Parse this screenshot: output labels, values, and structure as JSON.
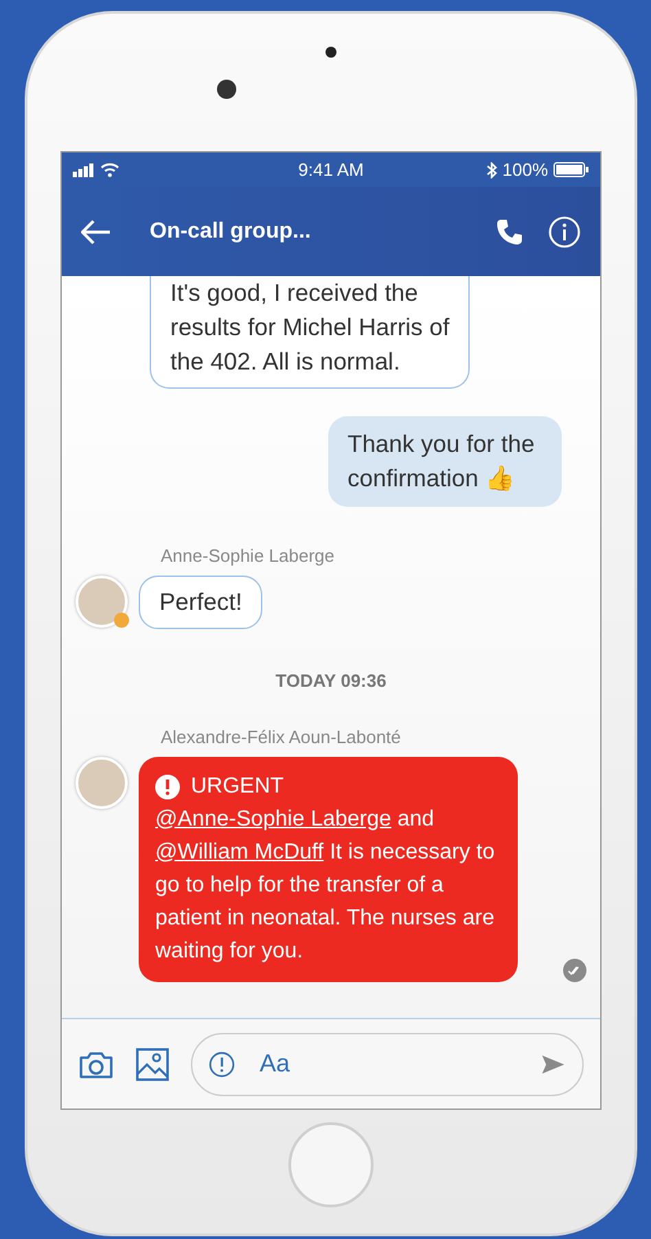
{
  "status_bar": {
    "time": "9:41 AM",
    "battery": "100%"
  },
  "header": {
    "title": "On-call group..."
  },
  "messages": [
    {
      "kind": "incoming",
      "cut_top": true,
      "lines": [
        "It's good, I received the",
        "results for Michel Harris of",
        "the 402. All is normal."
      ]
    },
    {
      "kind": "outgoing",
      "text": "Thank you for the confirmation",
      "emoji": "👍"
    },
    {
      "kind": "incoming",
      "sender": "Anne-Sophie Laberge",
      "avatar": {
        "color": "#f2a93b"
      },
      "lines": [
        "Perfect!"
      ]
    },
    {
      "kind": "date",
      "text": "TODAY 09:36"
    },
    {
      "kind": "urgent",
      "sender": "Alexandre-Félix Aoun-Labonté",
      "label": "URGENT",
      "parts": [
        {
          "kind": "mention",
          "text": "@Anne-Sophie Laberge"
        },
        {
          "kind": "text",
          "text": " and "
        },
        {
          "kind": "mention",
          "text": "@William McDuff"
        },
        {
          "kind": "text",
          "text": " It is necessary to go to help for the transfer of a patient in neonatal. The nurses are waiting for you."
        }
      ],
      "read": true
    }
  ],
  "composer": {
    "placeholder": "Aa"
  }
}
